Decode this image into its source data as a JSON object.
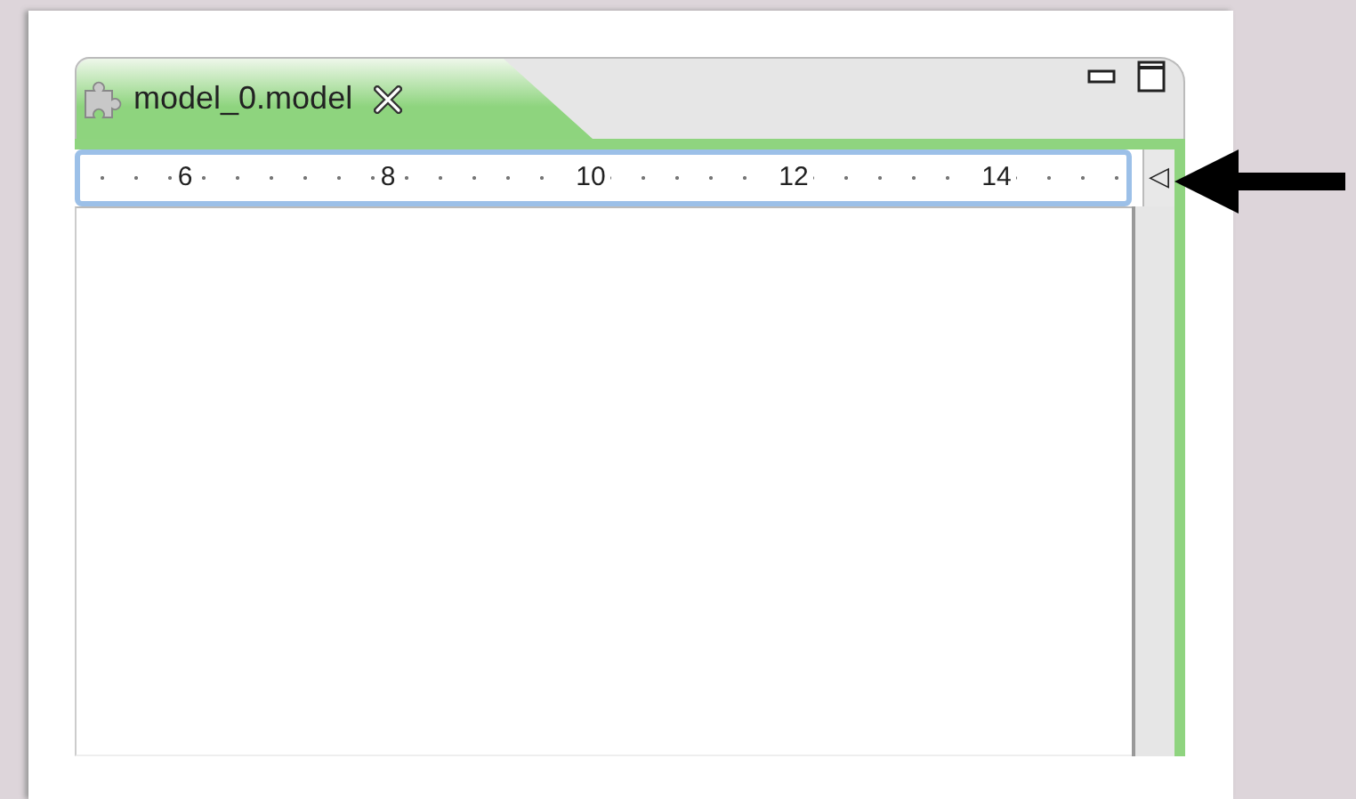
{
  "editor": {
    "tab": {
      "title": "model_0.model",
      "selected": true,
      "closable": true
    },
    "view_buttons": [
      {
        "kind": "minimize"
      },
      {
        "kind": "maximize"
      }
    ],
    "ruler": {
      "labels": [
        "6",
        "8",
        "10",
        "12",
        "14"
      ]
    },
    "collapse_button": {
      "glyph": "◁"
    }
  },
  "annotation": {
    "kind": "arrow"
  }
}
